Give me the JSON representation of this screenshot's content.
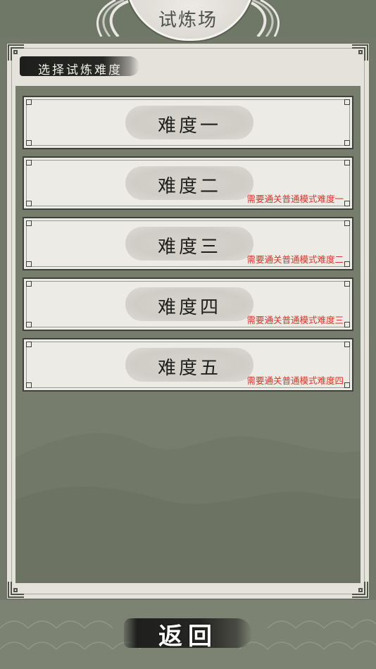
{
  "header": {
    "title": "试炼场"
  },
  "section": {
    "subtitle": "选择试炼难度"
  },
  "difficulties": [
    {
      "label": "难度一",
      "requirement": ""
    },
    {
      "label": "难度二",
      "requirement": "需要通关普通模式难度一"
    },
    {
      "label": "难度三",
      "requirement": "需要通关普通模式难度二"
    },
    {
      "label": "难度四",
      "requirement": "需要通关普通模式难度三"
    },
    {
      "label": "难度五",
      "requirement": "需要通关普通模式难度四"
    }
  ],
  "footer": {
    "back_label": "返回"
  },
  "colors": {
    "requirement_text": "#e0322b",
    "panel_bg": "#e4e2da",
    "list_bg": "#767d6c"
  }
}
